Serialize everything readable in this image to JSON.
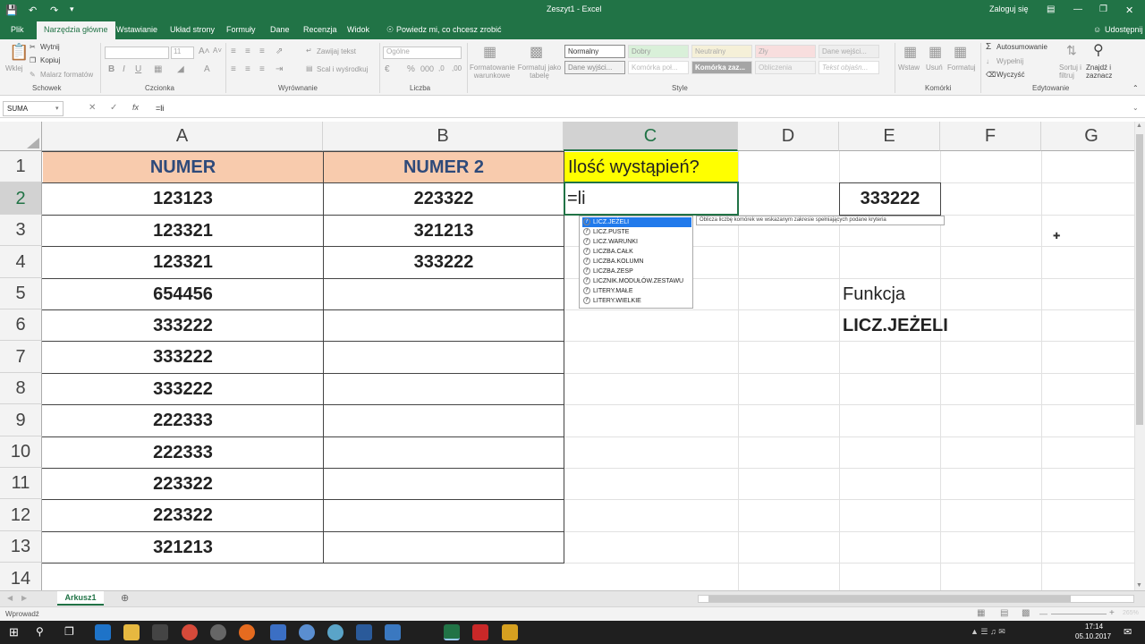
{
  "titlebar": {
    "doc_title": "Zeszyt1 - Excel",
    "signin": "Zaloguj się"
  },
  "ribbon_tabs": [
    "Plik",
    "Narzędzia główne",
    "Wstawianie",
    "Układ strony",
    "Formuły",
    "Dane",
    "Recenzja",
    "Widok"
  ],
  "tell_me": "Powiedz mi, co chcesz zrobić",
  "share": "Udostępnij",
  "clipboard": {
    "paste": "Wklej",
    "cut": "Wytnij",
    "copy": "Kopiuj",
    "painter": "Malarz formatów",
    "group": "Schowek"
  },
  "font": {
    "size": "11",
    "group": "Czcionka"
  },
  "alignment": {
    "wrap": "Zawijaj tekst",
    "merge": "Scal i wyśrodkuj",
    "group": "Wyrównanie"
  },
  "number": {
    "format": "Ogólne",
    "group": "Liczba"
  },
  "styles": {
    "cond_format": "Formatowanie warunkowe",
    "format_table": "Formatuj jako tabelę",
    "items": [
      "Normalny",
      "Dobry",
      "Neutralny",
      "Zły",
      "Dane wejści...",
      "Dane wyjści...",
      "Komórka poł...",
      "Komórka zaz...",
      "Obliczenia",
      "Tekst objaśn..."
    ],
    "group": "Style"
  },
  "cells_group": {
    "insert": "Wstaw",
    "delete": "Usuń",
    "format": "Formatuj",
    "group": "Komórki"
  },
  "editing": {
    "autosum": "Autosumowanie",
    "fill": "Wypełnij",
    "clear": "Wyczyść",
    "sort": "Sortuj i filtruj",
    "find": "Znajdź i zaznacz",
    "group": "Edytowanie"
  },
  "formula_bar": {
    "name_box": "SUMA",
    "formula": "=li",
    "fx": "fx"
  },
  "columns": [
    "A",
    "B",
    "C",
    "D",
    "E",
    "F",
    "G"
  ],
  "rows": [
    "1",
    "2",
    "3",
    "4",
    "5",
    "6",
    "7",
    "8",
    "9",
    "10",
    "11",
    "12",
    "13",
    "14"
  ],
  "sheet": {
    "A1": "NUMER",
    "B1": "NUMER 2",
    "C1": "Ilość wystąpień?",
    "colA": [
      "123123",
      "123321",
      "123321",
      "654456",
      "333222",
      "333222",
      "333222",
      "222333",
      "222333",
      "223322",
      "223322",
      "321213"
    ],
    "colB": [
      "223322",
      "321213",
      "333222"
    ],
    "C2": "=li",
    "E2": "333222",
    "E5": "Funkcja",
    "E6": "LICZ.JEŻELI"
  },
  "autocomplete": [
    "LICZ.JEŻELI",
    "LICZ.PUSTE",
    "LICZ.WARUNKI",
    "LICZBA.CAŁK",
    "LICZBA.KOLUMN",
    "LICZBA.ZESP",
    "LICZNIK.MODUŁÓW.ZESTAWU",
    "LITERY.MAŁE",
    "LITERY.WIELKIE"
  ],
  "tooltip": "Oblicza liczbę komórek we wskazanym zakresie spełniających podane kryteria",
  "sheet_tab": "Arkusz1",
  "status": {
    "mode": "Wprowadź",
    "zoom": "265%"
  },
  "clock": {
    "time": "17:14",
    "date": "05.10.2017"
  },
  "colors": {
    "excel_green": "#217346",
    "header_orange": "#f8cbad",
    "yellow": "#ffff00",
    "ac_select": "#217aeb"
  }
}
